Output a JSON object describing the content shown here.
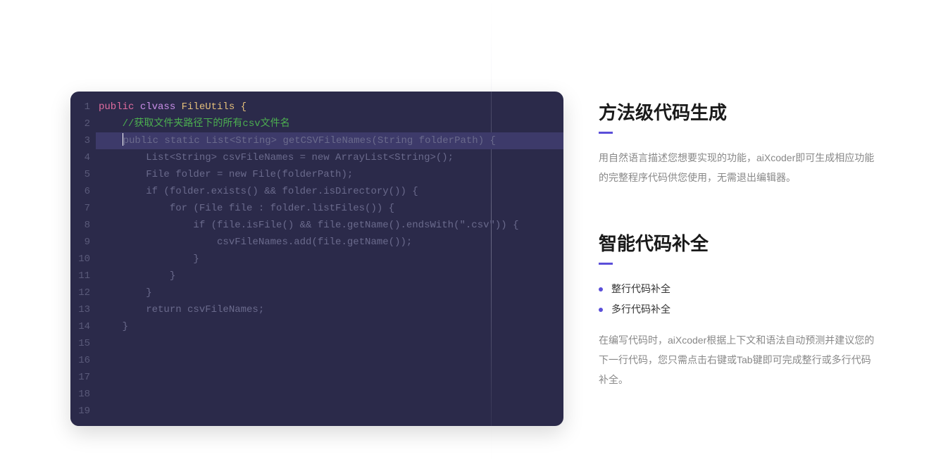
{
  "editor": {
    "lineCount": 19,
    "lines": [
      {
        "segments": [
          {
            "text": "public ",
            "cls": "kw-public"
          },
          {
            "text": "clvass ",
            "cls": "kw-class"
          },
          {
            "text": "FileUtils ",
            "cls": "classname"
          },
          {
            "text": "{",
            "cls": "brace"
          }
        ]
      },
      {
        "segments": [
          {
            "text": "    ",
            "cls": ""
          },
          {
            "text": "//获取文件夹路径下的所有csv文件名",
            "cls": "comment"
          }
        ]
      },
      {
        "highlighted": true,
        "segments": [
          {
            "text": "    ",
            "cls": ""
          },
          {
            "text": "|",
            "cls": "cursor-marker"
          },
          {
            "text": "public static List<String> getCSVFileNames(String folderPath) {",
            "cls": "dimmed"
          }
        ]
      },
      {
        "segments": [
          {
            "text": "        List<String> csvFileNames = new ArrayList<String>();",
            "cls": "dimmed"
          }
        ]
      },
      {
        "segments": [
          {
            "text": "        File folder = new File(folderPath);",
            "cls": "dimmed"
          }
        ]
      },
      {
        "segments": [
          {
            "text": "        if (folder.exists() && folder.isDirectory()) {",
            "cls": "dimmed"
          }
        ]
      },
      {
        "segments": [
          {
            "text": "            for (File file : folder.listFiles()) {",
            "cls": "dimmed"
          }
        ]
      },
      {
        "segments": [
          {
            "text": "                if (file.isFile() && file.getName().endsWith(\".csv\")) {",
            "cls": "dimmed"
          }
        ]
      },
      {
        "segments": [
          {
            "text": "                    csvFileNames.add(file.getName());",
            "cls": "dimmed"
          }
        ]
      },
      {
        "segments": [
          {
            "text": "                }",
            "cls": "dimmed"
          }
        ]
      },
      {
        "segments": [
          {
            "text": "            }",
            "cls": "dimmed"
          }
        ]
      },
      {
        "segments": [
          {
            "text": "        }",
            "cls": "dimmed"
          }
        ]
      },
      {
        "segments": [
          {
            "text": "        return csvFileNames;",
            "cls": "dimmed"
          }
        ]
      },
      {
        "segments": [
          {
            "text": "    }",
            "cls": "dimmed"
          }
        ]
      },
      {
        "segments": []
      },
      {
        "segments": []
      },
      {
        "segments": []
      },
      {
        "segments": []
      },
      {
        "segments": []
      }
    ]
  },
  "sections": [
    {
      "title": "方法级代码生成",
      "bullets": [],
      "description": "用自然语言描述您想要实现的功能，aiXcoder即可生成相应功能的完整程序代码供您使用，无需退出编辑器。"
    },
    {
      "title": "智能代码补全",
      "bullets": [
        "整行代码补全",
        "多行代码补全"
      ],
      "description": "在编写代码时，aiXcoder根据上下文和语法自动预测并建议您的下一行代码，您只需点击右键或Tab键即可完成整行或多行代码补全。"
    }
  ]
}
